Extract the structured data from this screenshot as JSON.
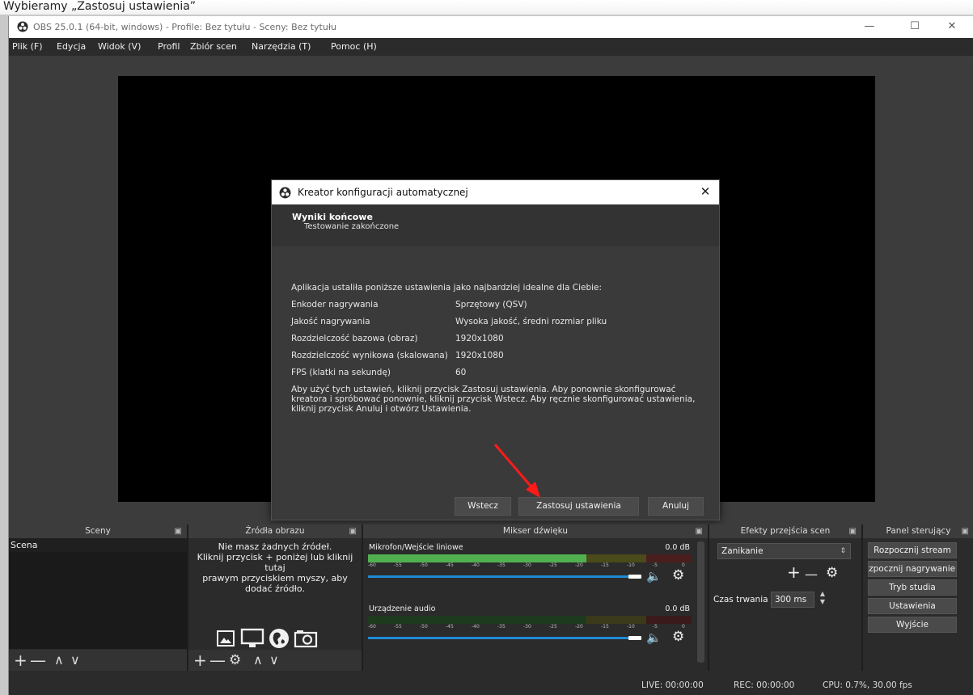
{
  "caption": "Wybieramy „Zastosuj ustawienia”",
  "window": {
    "title": "OBS 25.0.1 (64-bit, windows) - Profile: Bez tytułu - Sceny: Bez tytułu",
    "minimize_icon": "—",
    "maximize_icon": "☐",
    "close_icon": "✕"
  },
  "menu": [
    "Plik (F)",
    "Edycja",
    "Widok (V)",
    "Profil",
    "Zbiór scen",
    "Narzędzia (T)",
    "Pomoc (H)"
  ],
  "dialog": {
    "title": "Kreator konfiguracji automatycznej",
    "close_icon": "✕",
    "heading": "Wyniki końcowe",
    "subheading": "Testowanie zakończone",
    "intro": "Aplikacja ustaliła poniższe ustawienia jako najbardziej idealne dla Ciebie:",
    "settings": [
      {
        "label": "Enkoder nagrywania",
        "value": "Sprzętowy (QSV)"
      },
      {
        "label": "Jakość nagrywania",
        "value": "Wysoka jakość, średni rozmiar pliku"
      },
      {
        "label": "Rozdzielczość bazowa (obraz)",
        "value": "1920x1080"
      },
      {
        "label": "Rozdzielczość wynikowa (skalowana)",
        "value": "1920x1080"
      },
      {
        "label": "FPS (klatki na sekundę)",
        "value": "60"
      }
    ],
    "note": "Aby użyć tych ustawień, kliknij przycisk Zastosuj ustawienia. Aby ponownie skonfigurować kreatora i spróbować ponownie, kliknij przycisk Wstecz. Aby ręcznie skonfigurować ustawienia, kliknij przycisk Anuluj i otwórz Ustawienia.",
    "buttons": {
      "back": "Wstecz",
      "apply": "Zastosuj ustawienia",
      "cancel": "Anuluj"
    }
  },
  "docks": {
    "scenes": {
      "title": "Sceny",
      "item": "Scena"
    },
    "sources": {
      "title": "Źródła obrazu",
      "empty": [
        "Nie masz żadnych źródeł.",
        "Kliknij przycisk + poniżej lub kliknij",
        "tutaj",
        "prawym przyciskiem myszy, aby",
        "dodać źródło."
      ]
    },
    "mixer": {
      "title": "Mikser dźwięku",
      "channels": [
        {
          "name": "Mikrofon/Wejście liniowe",
          "db": "0.0 dB",
          "level": 0.82
        },
        {
          "name": "Urządzenie audio",
          "db": "0.0 dB",
          "level": 0.0
        }
      ],
      "ticks": [
        "-60",
        "-55",
        "-50",
        "-45",
        "-40",
        "-35",
        "-30",
        "-25",
        "-20",
        "-15",
        "-10",
        "-5",
        "0"
      ]
    },
    "transitions": {
      "title": "Efekty przejścia scen",
      "selected": "Zanikanie",
      "duration_label": "Czas trwania",
      "duration_value": "300 ms"
    },
    "controls": {
      "title": "Panel sterujący",
      "buttons": [
        "Rozpocznij stream",
        "Rozpocznij nagrywanie",
        "Tryb studia",
        "Ustawienia",
        "Wyjście"
      ]
    }
  },
  "status": {
    "live": "LIVE: 00:00:00",
    "rec": "REC: 00:00:00",
    "cpu": "CPU: 0.7%, 30.00 fps"
  }
}
